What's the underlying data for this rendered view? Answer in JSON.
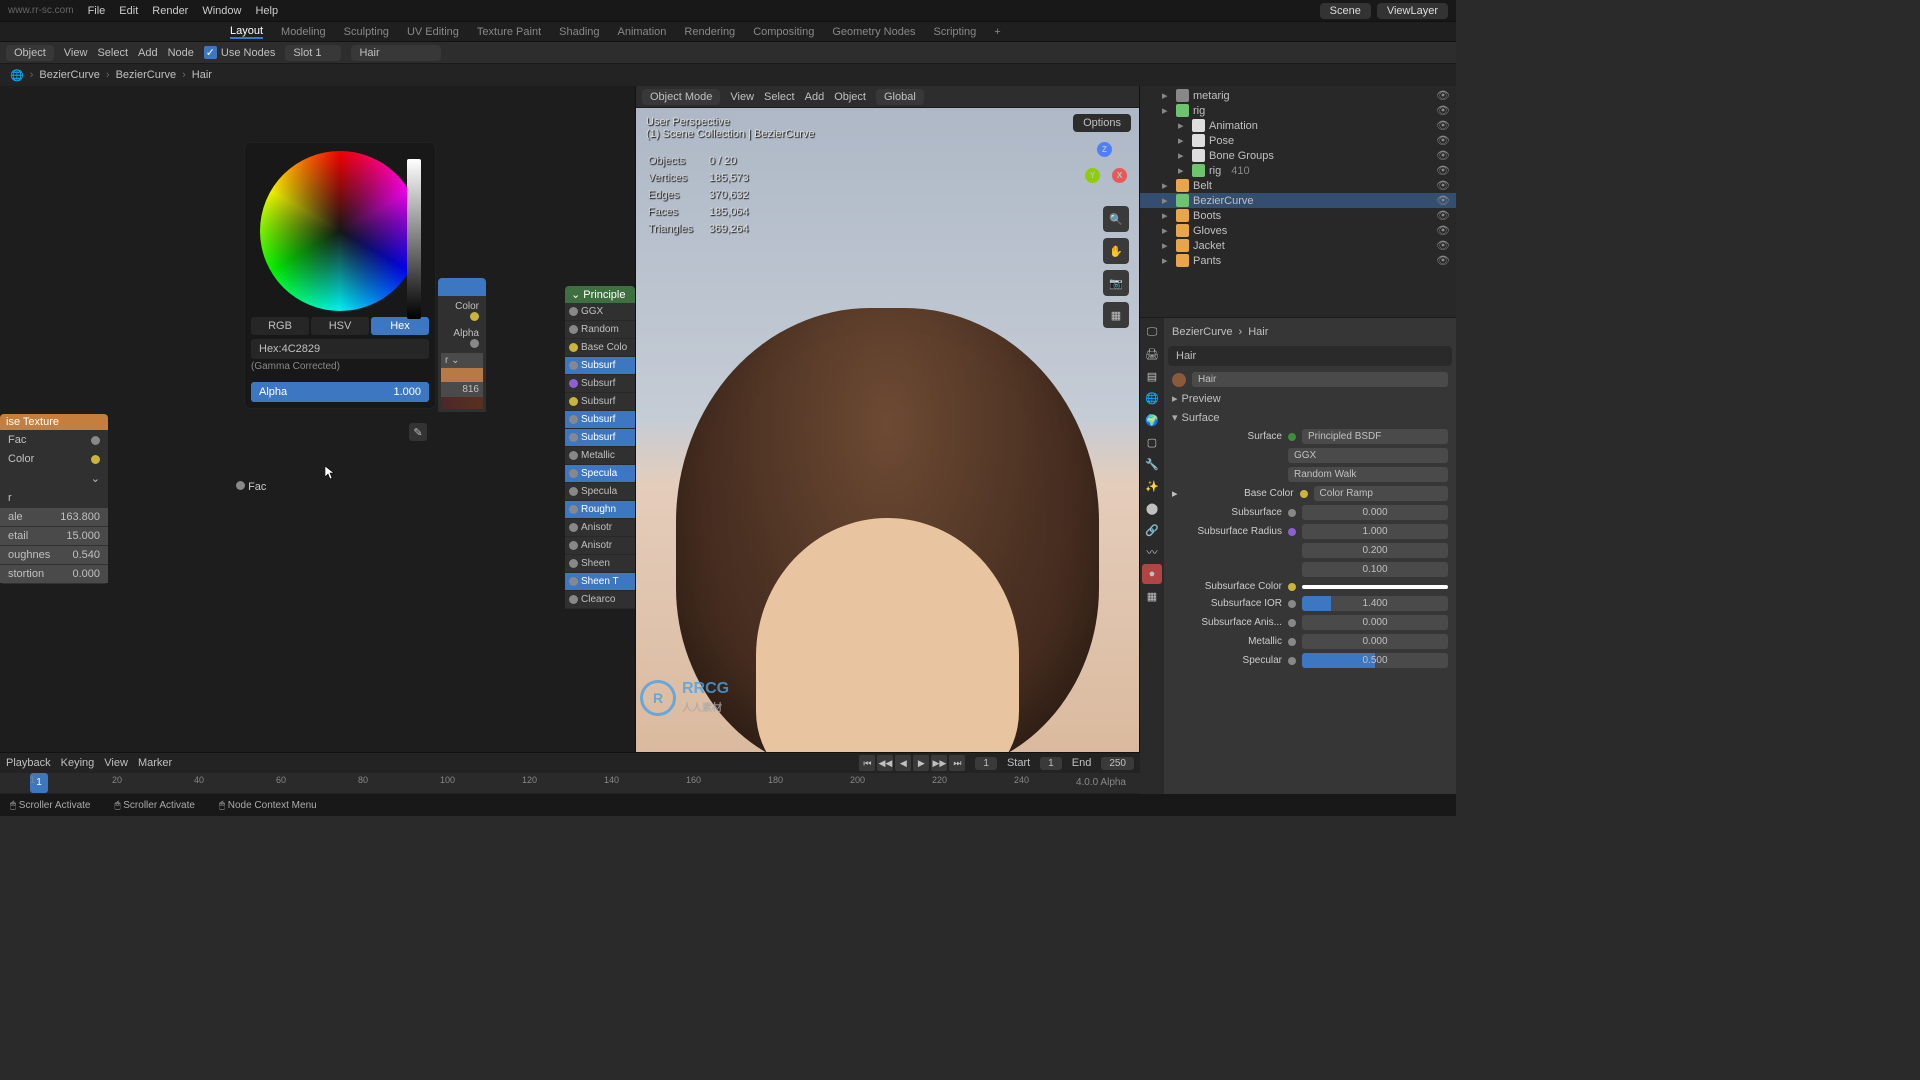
{
  "topmenu": {
    "file": "File",
    "edit": "Edit",
    "render": "Render",
    "window": "Window",
    "help": "Help",
    "watermark": "www.rr-sc.com"
  },
  "scene": {
    "label": "Scene",
    "layer": "ViewLayer"
  },
  "workspace": {
    "tabs": [
      "Layout",
      "Modeling",
      "Sculpting",
      "UV Editing",
      "Texture Paint",
      "Shading",
      "Animation",
      "Rendering",
      "Compositing",
      "Geometry Nodes",
      "Scripting"
    ],
    "active": "Layout"
  },
  "node_toolbar": {
    "mode": "Object",
    "view": "View",
    "select": "Select",
    "add": "Add",
    "node": "Node",
    "usenodes": "Use Nodes",
    "slot": "Slot 1",
    "material": "Hair"
  },
  "breadcrumb": {
    "a": "BezierCurve",
    "b": "BezierCurve",
    "c": "Hair"
  },
  "noise_node": {
    "title": "ise Texture",
    "fac": "Fac",
    "color": "Color",
    "dim": "",
    "scale_label": "ale",
    "scale_val": "163.800",
    "detail_label": "etail",
    "detail_val": "15.000",
    "rough_label": "oughnes",
    "rough_val": "0.540",
    "dist_label": "stortion",
    "dist_val": "0.000"
  },
  "color_popup": {
    "tabs": [
      "RGB",
      "HSV",
      "Hex"
    ],
    "active_tab": "Hex",
    "hex_label": "Hex:4C2829",
    "gamma": "(Gamma Corrected)",
    "alpha_label": "Alpha",
    "alpha_val": "1.000"
  },
  "colorramp_partial": {
    "color": "Color",
    "alpha": "Alpha",
    "r": "r",
    "val816": "816",
    "fac": "Fac"
  },
  "principled": {
    "title": "Principle",
    "rows": [
      "GGX",
      "Random",
      "Base Colo",
      "Subsurf",
      "Subsurf",
      "Subsurf",
      "Subsurf",
      "Subsurf",
      "Metallic",
      "Specula",
      "Specula",
      "Roughn",
      "Anisotr",
      "Anisotr",
      "Sheen",
      "Sheen T",
      "Clearco"
    ]
  },
  "vp_header": {
    "mode": "Object Mode",
    "view": "View",
    "select": "Select",
    "add": "Add",
    "object": "Object",
    "orient": "Global"
  },
  "vp_overlay": {
    "persp": "User Perspective",
    "coll": "(1) Scene Collection | BezierCurve",
    "objects_l": "Objects",
    "objects_v": "0 / 20",
    "verts_l": "Vertices",
    "verts_v": "185,573",
    "edges_l": "Edges",
    "edges_v": "370,632",
    "faces_l": "Faces",
    "faces_v": "185,064",
    "tris_l": "Triangles",
    "tris_v": "369,264",
    "options": "Options"
  },
  "outliner": {
    "rows": [
      {
        "name": "metarig",
        "indent": 1,
        "color": "#888"
      },
      {
        "name": "rig",
        "indent": 1,
        "color": "#6ec36e"
      },
      {
        "name": "Animation",
        "indent": 2,
        "color": "#ddd"
      },
      {
        "name": "Pose",
        "indent": 2,
        "color": "#ddd"
      },
      {
        "name": "Bone Groups",
        "indent": 2,
        "color": "#ddd"
      },
      {
        "name": "rig",
        "indent": 2,
        "color": "#6ec36e",
        "extra": "410"
      },
      {
        "name": "Belt",
        "indent": 1,
        "color": "#e8a54a"
      },
      {
        "name": "BezierCurve",
        "indent": 1,
        "color": "#6ec36e",
        "active": true
      },
      {
        "name": "Boots",
        "indent": 1,
        "color": "#e8a54a"
      },
      {
        "name": "Gloves",
        "indent": 1,
        "color": "#e8a54a"
      },
      {
        "name": "Jacket",
        "indent": 1,
        "color": "#e8a54a"
      },
      {
        "name": "Pants",
        "indent": 1,
        "color": "#e8a54a"
      }
    ]
  },
  "props": {
    "bc_a": "BezierCurve",
    "bc_b": "Hair",
    "mat_slot": "Hair",
    "mat_name": "Hair",
    "preview": "Preview",
    "surface_panel": "Surface",
    "surface_label": "Surface",
    "surface_val": "Principled BSDF",
    "ggx": "GGX",
    "randwalk": "Random Walk",
    "basecolor_l": "Base Color",
    "basecolor_v": "Color Ramp",
    "subsurf_l": "Subsurface",
    "subsurf_v": "0.000",
    "subr_l": "Subsurface Radius",
    "subr1": "1.000",
    "subr2": "0.200",
    "subr3": "0.100",
    "subc_l": "Subsurface Color",
    "subi_l": "Subsurface IOR",
    "subi_v": "1.400",
    "suba_l": "Subsurface Anis...",
    "suba_v": "0.000",
    "met_l": "Metallic",
    "met_v": "0.000",
    "spec_l": "Specular",
    "spec_v": "0.500"
  },
  "timeline": {
    "playback": "Playback",
    "keying": "Keying",
    "view": "View",
    "marker": "Marker",
    "frame": "1",
    "start_l": "Start",
    "start_v": "1",
    "end_l": "End",
    "end_v": "250",
    "ticks": [
      "1",
      "20",
      "40",
      "60",
      "80",
      "100",
      "120",
      "140",
      "160",
      "180",
      "200",
      "220",
      "240"
    ]
  },
  "statusbar": {
    "scroll1": "Scroller Activate",
    "scroll2": "Scroller Activate",
    "nodectx": "Node Context Menu"
  }
}
